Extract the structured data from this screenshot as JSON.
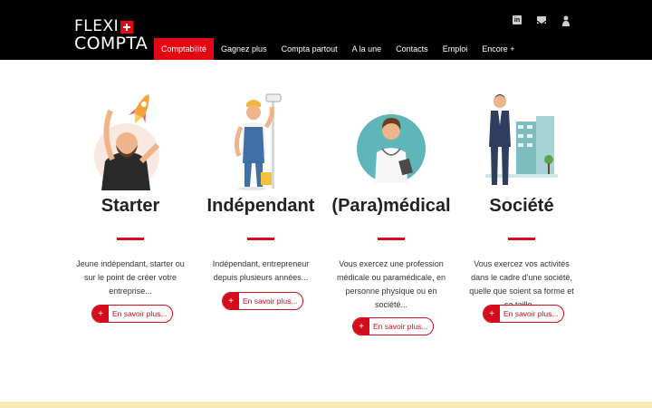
{
  "header": {
    "logo": {
      "line1": "FLEXI",
      "line2": "COMPTA"
    },
    "social": [
      {
        "icon": "linkedin-icon"
      },
      {
        "icon": "mail-icon"
      },
      {
        "icon": "user-icon"
      }
    ],
    "nav": [
      {
        "label": "Comptabilité",
        "active": true
      },
      {
        "label": "Gagnez plus"
      },
      {
        "label": "Compta partout"
      },
      {
        "label": "A la une"
      },
      {
        "label": "Contacts"
      },
      {
        "label": "Emploi"
      },
      {
        "label": "Encore +"
      }
    ]
  },
  "cards": [
    {
      "title": "Starter",
      "description": "Jeune indépendant, starter ou sur le point de créer votre entreprise...",
      "button": "En savoir plus..."
    },
    {
      "title": "Indépendant",
      "description": "Indépendant, entrepreneur depuis plusieurs années...",
      "button": "En savoir plus..."
    },
    {
      "title": "(Para)médical",
      "description": "Vous exercez une profession médicale ou paramédicale, en personne physique ou en société...",
      "button": "En savoir plus..."
    },
    {
      "title": "Société",
      "description": "Vous exercez vos activités dans le cadre d'une société, quelle que soient sa forme et sa taille...",
      "button": "En savoir plus..."
    }
  ]
}
